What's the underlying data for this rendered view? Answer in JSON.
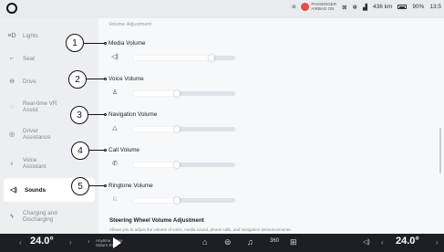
{
  "status_bar": {
    "airbag_line1": "PASSENGER",
    "airbag_line2": "AIRBAG ON",
    "range": "436 km",
    "battery": "90%",
    "time": "13:5"
  },
  "sidebar": {
    "items": [
      {
        "label": "Lights",
        "icon": "lights-icon",
        "glyph": "≡D"
      },
      {
        "label": "Seat",
        "icon": "seat-icon",
        "glyph": "⌐"
      },
      {
        "label": "Drive",
        "icon": "steering-wheel-icon",
        "glyph": "⊖"
      },
      {
        "label": "Real-time VR Assist",
        "icon": "vr-assist-icon",
        "glyph": "◌"
      },
      {
        "label": "Driver Assistance",
        "icon": "driver-assist-icon",
        "glyph": "◎"
      },
      {
        "label": "Voice Assistant",
        "icon": "voice-assistant-icon",
        "glyph": "♁"
      },
      {
        "label": "Sounds",
        "icon": "speaker-icon",
        "glyph": "◁)",
        "active": true
      },
      {
        "label": "Charging and Discharging",
        "icon": "charging-icon",
        "glyph": "ϟ"
      }
    ]
  },
  "main": {
    "section_title": "Volume Adjustment",
    "volumes": [
      {
        "label": "Media Volume",
        "icon": "speaker-icon",
        "glyph": "◁)",
        "level": 0.77,
        "callout": "1"
      },
      {
        "label": "Voice Volume",
        "icon": "voice-icon",
        "glyph": "♙",
        "level": 0.43,
        "callout": "2"
      },
      {
        "label": "Navigation Volume",
        "icon": "navigation-icon",
        "glyph": "△",
        "level": 0.43,
        "callout": "3"
      },
      {
        "label": "Call Volume",
        "icon": "phone-icon",
        "glyph": "✆",
        "level": 0.43,
        "callout": "4"
      },
      {
        "label": "Ringtone Volume",
        "icon": "bell-icon",
        "glyph": "♘",
        "level": 0.43,
        "callout": "5"
      }
    ],
    "steering_title": "Steering Wheel Volume Adjustment",
    "steering_desc": "Allows you to adjust the volume of voice, media sound, phone calls, and navigation announcements."
  },
  "bottom_bar": {
    "left_temp": "24.0°",
    "right_temp": "24.0°",
    "media_line1": "Anytime, Anyw",
    "media_line2": "Saturn Ridd"
  },
  "colors": {
    "airbag": "#e74c3c",
    "bottom_bar": "#1e1f24"
  }
}
